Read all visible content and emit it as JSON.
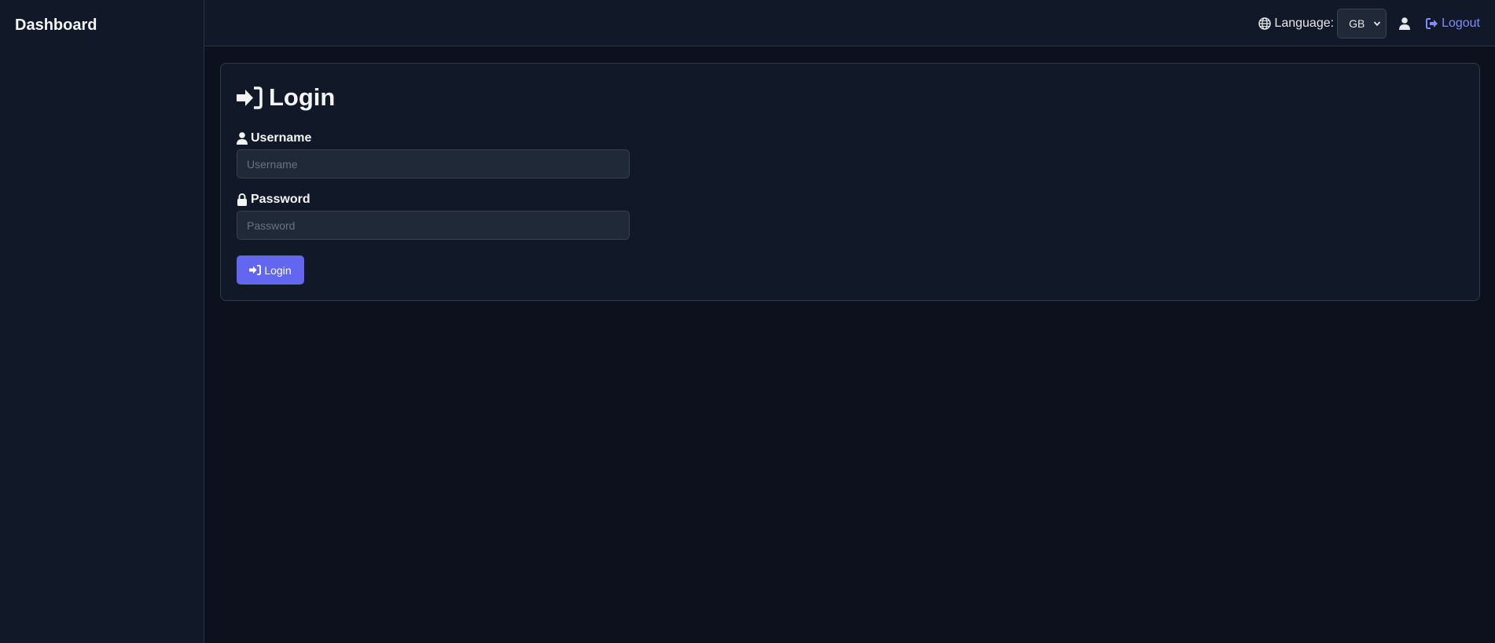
{
  "sidebar": {
    "brand": "Dashboard"
  },
  "topbar": {
    "language_label": "Language:",
    "language_value": "GB",
    "user_icon": "user-icon",
    "logout_label": "Logout"
  },
  "login_form": {
    "title": "Login",
    "username": {
      "label": "Username",
      "value": "",
      "placeholder": "Username"
    },
    "password": {
      "label": "Password",
      "value": "",
      "placeholder": "Password"
    },
    "submit_label": "Login"
  },
  "icons": {
    "globe": "globe-icon",
    "sign_in": "sign-in-icon",
    "lock": "lock-icon",
    "sign_out": "sign-out-icon",
    "chevron": "chevron-down-icon"
  },
  "colors": {
    "background": "#0c111d",
    "panel": "#111827",
    "input_bg": "#1f2937",
    "accent": "#6366f1",
    "link": "#818cf8",
    "text": "#e5e7eb"
  }
}
